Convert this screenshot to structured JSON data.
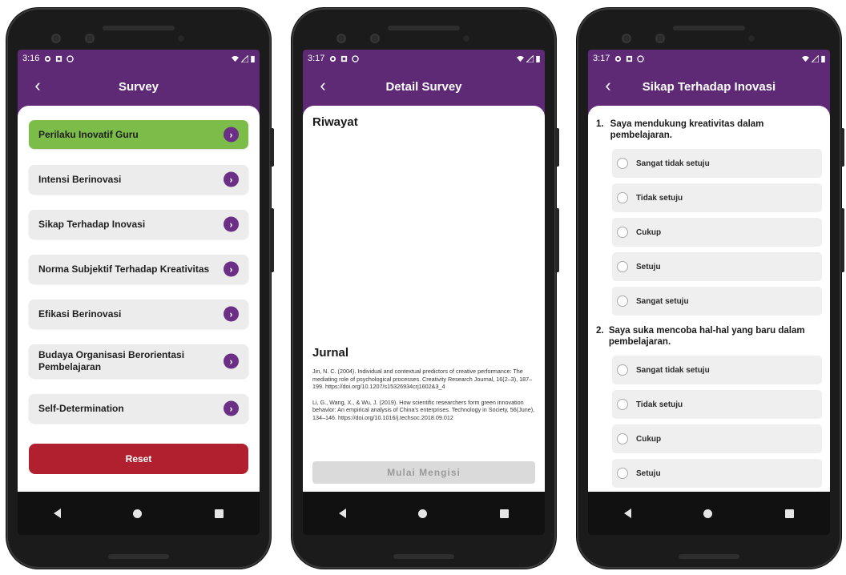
{
  "screen1": {
    "status": {
      "time": "3:16"
    },
    "title": "Survey",
    "items": [
      {
        "label": "Perilaku Inovatif Guru",
        "active": true
      },
      {
        "label": "Intensi Berinovasi"
      },
      {
        "label": "Sikap Terhadap Inovasi"
      },
      {
        "label": "Norma Subjektif Terhadap Kreativitas"
      },
      {
        "label": "Efikasi Berinovasi"
      },
      {
        "label": "Budaya Organisasi Berorientasi Pembelajaran"
      },
      {
        "label": "Self-Determination"
      }
    ],
    "reset_label": "Reset"
  },
  "screen2": {
    "status": {
      "time": "3:17"
    },
    "title": "Detail Survey",
    "riwayat_heading": "Riwayat",
    "jurnal_heading": "Jurnal",
    "references": [
      "Jin, N. C. (2004). Individual and contextual predictors of creative performance: The mediating role of psychological processes. Creativity Research Journal, 16(2–3), 187–199. https://doi.org/10.1207/s15326934crj1602&3_4",
      "Li, G., Wang, X., & Wu, J. (2019). How scientific researchers form green innovation behavior: An empirical analysis of China's enterprises. Technology in Society, 56(June), 134–146. https://doi.org/10.1016/j.techsoc.2018.09.012"
    ],
    "start_label": "Mulai Mengisi"
  },
  "screen3": {
    "status": {
      "time": "3:17"
    },
    "title": "Sikap Terhadap Inovasi",
    "questions": [
      {
        "number": "1.",
        "text": "Saya mendukung kreativitas dalam pembelajaran.",
        "options": [
          "Sangat tidak setuju",
          "Tidak setuju",
          "Cukup",
          "Setuju",
          "Sangat setuju"
        ]
      },
      {
        "number": "2.",
        "text": "Saya suka mencoba hal-hal yang baru dalam pembelajaran.",
        "options": [
          "Sangat tidak setuju",
          "Tidak setuju",
          "Cukup",
          "Setuju"
        ]
      }
    ]
  },
  "colors": {
    "header_purple": "#5e2a76",
    "active_green": "#7cbd4a",
    "reset_red": "#b0202e",
    "chevron_purple": "#6b3085"
  },
  "icons": {
    "back": "‹",
    "chevron": "›"
  }
}
